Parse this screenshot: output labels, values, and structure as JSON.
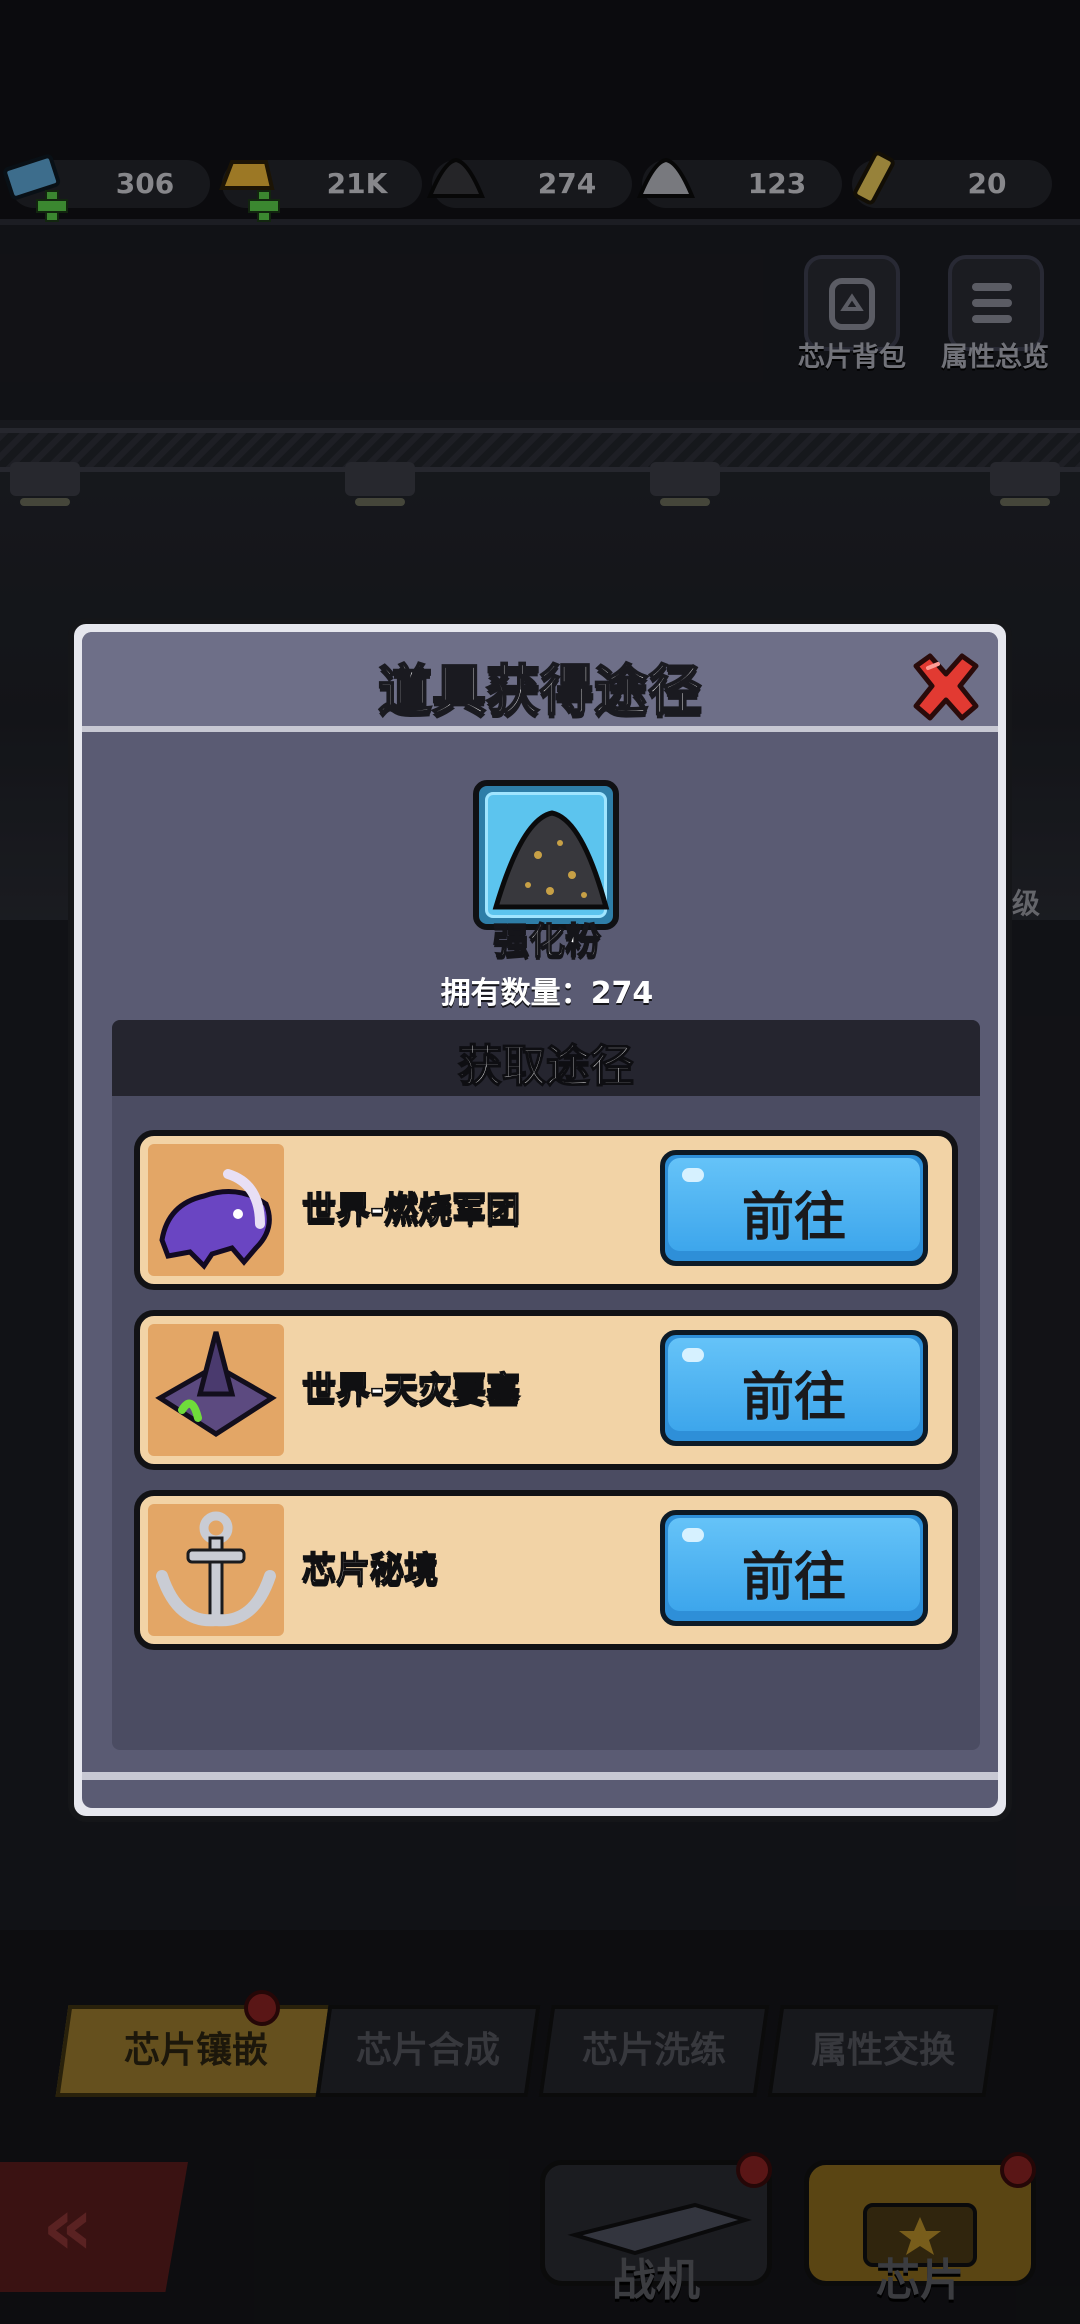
{
  "resources": [
    {
      "icon": "ticket-icon",
      "value": "306",
      "has_plus": true
    },
    {
      "icon": "gold-bar-icon",
      "value": "21K",
      "has_plus": true
    },
    {
      "icon": "dark-powder-icon",
      "value": "274",
      "has_plus": false
    },
    {
      "icon": "silver-powder-icon",
      "value": "123",
      "has_plus": false
    },
    {
      "icon": "tube-icon",
      "value": "20",
      "has_plus": false
    }
  ],
  "top_buttons": {
    "chip_bag": "芯片背包",
    "attribute_overview": "属性总览"
  },
  "background_fragment": "级",
  "modal": {
    "title": "道具获得途径",
    "item_name": "强化粉",
    "count_label": "拥有数量：",
    "count_value": "274",
    "ways_title": "获取途径",
    "ways": [
      {
        "icon": "purple-dinosaur-icon",
        "label": "世界-燃烧军团",
        "button": "前往"
      },
      {
        "icon": "fortress-icon",
        "label": "世界-天灾要塞",
        "button": "前往"
      },
      {
        "icon": "anchor-icon",
        "label": "芯片秘境",
        "button": "前往"
      }
    ]
  },
  "tabs": [
    "芯片镶嵌",
    "芯片合成",
    "芯片洗练",
    "属性交换"
  ],
  "bottom_nav": {
    "fighter": "战机",
    "chip": "芯片"
  },
  "colors": {
    "go_button": "#3da6ec",
    "row_background": "#f2d3a6",
    "modal_body": "#5a5b73",
    "active_tab": "#9b7b2e",
    "close_red": "#e23a32"
  }
}
